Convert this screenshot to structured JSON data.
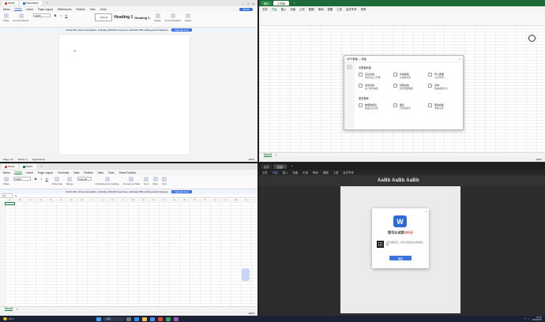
{
  "q1": {
    "tabs": [
      "Home",
      "Document1",
      "+"
    ],
    "menu": [
      "Menu",
      "Home",
      "Insert",
      "Page Layout",
      "References",
      "Review",
      "View",
      "Tools"
    ],
    "ribbon": [
      "Paste",
      "Format Painter",
      "Calibri",
      "B",
      "I",
      "U",
      "Normal",
      "Heading 1",
      "Heading 2",
      "Styles",
      "Find & Replace",
      "Select"
    ],
    "style_normal": "Normal",
    "style_h1": "Heading 1",
    "style_h2": "Heading 2",
    "notice": "Unlock 80+ fonts & templates. Including 100,000 resources, unlimited PDF editing and AI features",
    "notice_btn": "Upgrade Now",
    "status": [
      "Page: 1/1",
      "Words: 0",
      "Spell Check"
    ],
    "zoom": "100%"
  },
  "q2": {
    "tabs": [
      "稿件",
      "工作簿1",
      "+"
    ],
    "menu": [
      "文件",
      "开始",
      "插入",
      "页面",
      "公式",
      "数据",
      "审阅",
      "视图",
      "工具",
      "会员专享",
      "效率"
    ],
    "dialog_title": "WPS表格 — 新建",
    "dialog_section1": "无模板新建",
    "dialog_section2": "更多推荐",
    "dialog_items1": [
      {
        "title": "空白表格",
        "desc": "新建空白工作簿"
      },
      {
        "title": "表格模板",
        "desc": "从模板新建"
      },
      {
        "title": "导入数据",
        "desc": "从文件导入"
      },
      {
        "title": "在线表格",
        "desc": "多人协作编辑"
      },
      {
        "title": "智能表格",
        "desc": "轻松管理数据"
      },
      {
        "title": "表单",
        "desc": "快速收集信息"
      }
    ],
    "dialog_items2": [
      {
        "title": "数据透视表",
        "desc": "快速汇总分析"
      },
      {
        "title": "图表",
        "desc": "可视化展示"
      },
      {
        "title": "更多模板",
        "desc": "查看全部"
      }
    ],
    "sheet": "Sheet1",
    "zoom": "100%"
  },
  "q3": {
    "tabs": [
      "Home",
      "Book1",
      "+"
    ],
    "menu": [
      "Menu",
      "Home",
      "Insert",
      "Page Layout",
      "Formulas",
      "Data",
      "Review",
      "View",
      "Tools",
      "Smart Toolbox"
    ],
    "ribbon": [
      "Paste",
      "Calibri",
      "B",
      "I",
      "U",
      "Wrap Text",
      "Merge",
      "General",
      "Conditional Formatting",
      "Format as Table",
      "Sum",
      "Filter",
      "Sort"
    ],
    "namebox": "A1",
    "fx": "fx",
    "notice": "Unlock 80+ fonts & templates. Including 100,000 resources, unlimited PDF editing and AI features",
    "notice_btn": "Upgrade Now",
    "columns": [
      "A",
      "B",
      "C",
      "D",
      "E",
      "F",
      "G",
      "H",
      "I",
      "J",
      "K",
      "L",
      "M",
      "N",
      "O",
      "P",
      "Q",
      "R",
      "S",
      "T",
      "U",
      "V",
      "W",
      "X"
    ],
    "sheet": "Sheet1",
    "zoom": "100%"
  },
  "q4": {
    "tabs": [
      "文字",
      "文档1",
      "+"
    ],
    "menu": [
      "文件",
      "开始",
      "插入",
      "页面",
      "引用",
      "审阅",
      "视图",
      "工具",
      "会员专享"
    ],
    "style_preview": "AaBb AaBb AaBb",
    "trial_title": "您可以试用",
    "trial_days": "180天",
    "trial_text": "扫码领取会员，即可免费使用全部高级功能。",
    "trial_btn": "确定"
  },
  "taskbar": {
    "weather": "18°C",
    "search": "搜索",
    "time": "10:31",
    "date": "2024/5/16"
  },
  "colors": {
    "wps_blue": "#2f6bd8",
    "et_green": "#1a7f3c",
    "wps_red": "#e2463b"
  }
}
